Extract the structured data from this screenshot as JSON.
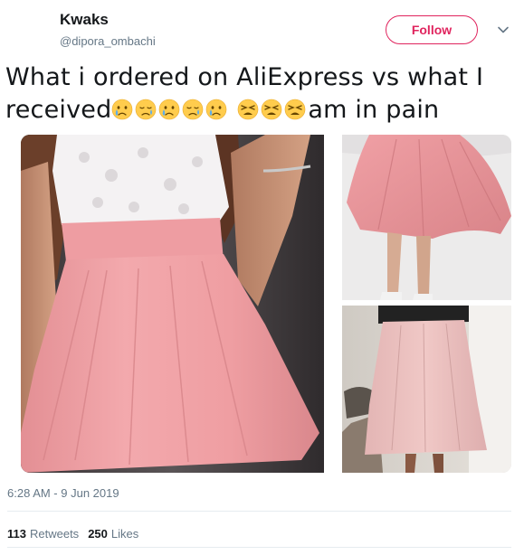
{
  "author": {
    "name": "Kwaks",
    "handle": "@dipora_ombachi"
  },
  "follow_label": "Follow",
  "tweet": {
    "line1": "What i ordered on AliExpress vs what I",
    "line2_prefix": "received",
    "line2_suffix": "am in pain",
    "emojis_group1": [
      "crying-face",
      "sad-relieved-face",
      "crying-face",
      "sad-relieved-face",
      "crying-face"
    ],
    "emojis_group2": [
      "tired-face",
      "tired-face",
      "tired-face"
    ]
  },
  "timestamp": "6:28 AM - 9 Jun 2019",
  "stats": {
    "retweets_count": "113",
    "retweets_label": "Retweets",
    "likes_count": "250",
    "likes_label": "Likes"
  },
  "colors": {
    "follow_accent": "#e0245e",
    "secondary_text": "#657786",
    "skirt_pink": "#f0a0a4"
  },
  "media_images": [
    "model-pink-skirt",
    "pink-skirt-spinning",
    "received-skirt-hanging"
  ]
}
